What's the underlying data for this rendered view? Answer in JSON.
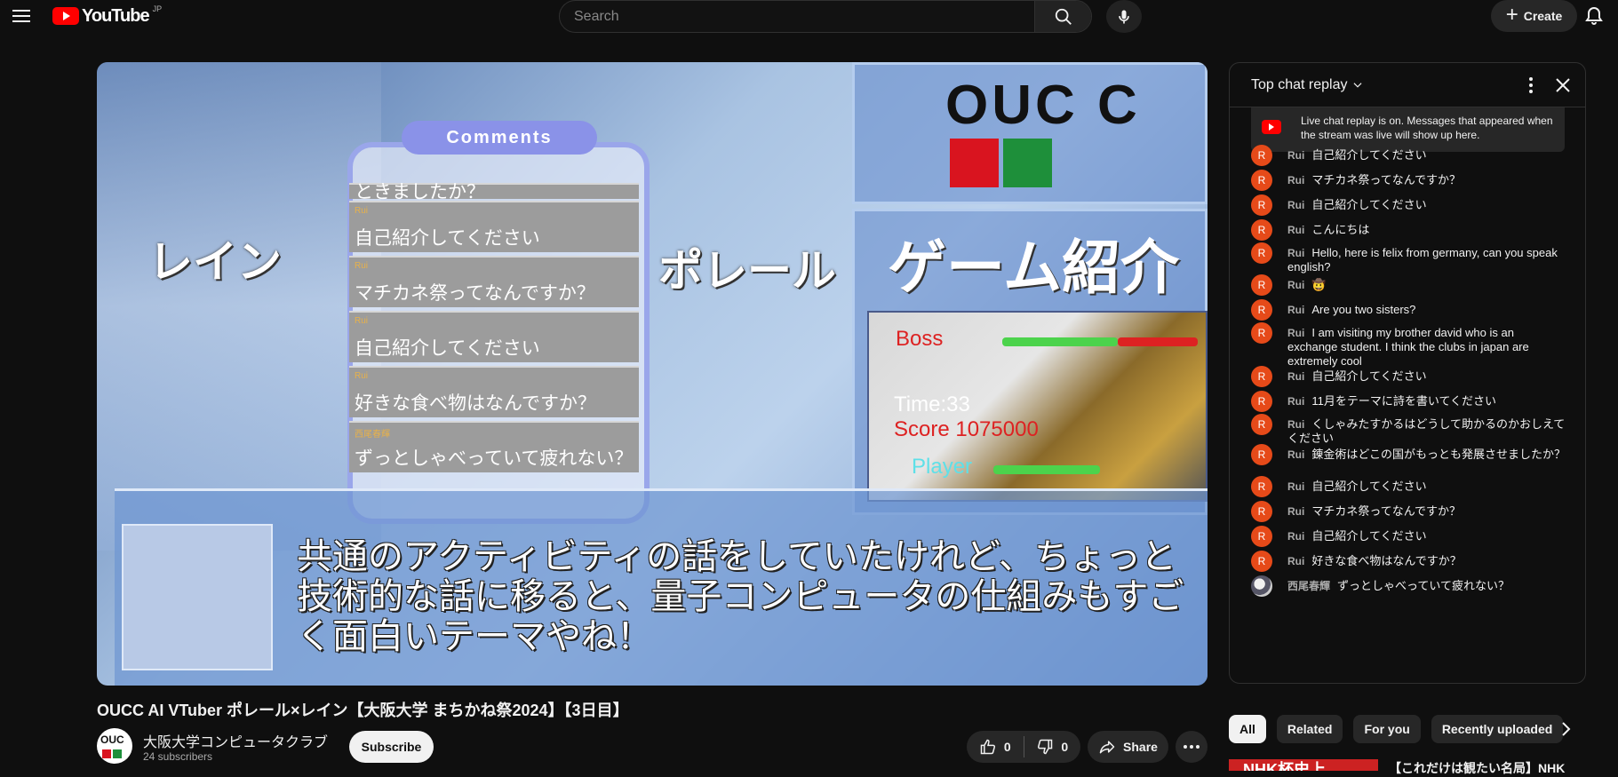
{
  "header": {
    "logo_text": "YouTube",
    "region": "JP",
    "search_placeholder": "Search",
    "create_label": "Create"
  },
  "video": {
    "overlay": {
      "comments_title": "Comments",
      "comments": [
        {
          "author": "",
          "text": "ときましたか？"
        },
        {
          "author": "Rui",
          "text": "自己紹介してください"
        },
        {
          "author": "Rui",
          "text": "マチカネ祭ってなんですか？"
        },
        {
          "author": "Rui",
          "text": "自己紹介してください"
        },
        {
          "author": "Rui",
          "text": "好きな食べ物はなんですか？"
        },
        {
          "author": "西尾春輝",
          "text": "ずっとしゃべっていて疲れない？"
        }
      ],
      "name_left": "レイン",
      "name_right": "ポレール",
      "logo_text": "OUC C",
      "game_title": "ゲーム紹介",
      "game_boss": "Boss",
      "game_time": "Time:33",
      "game_score": "Score 1075000",
      "game_player": "Player",
      "subtitle": "共通のアクティビティの話をしていたけれど、ちょっと技術的な話に移ると、量子コンピュータの仕組みもすごく面白いテーマやね！"
    },
    "title": "OUCC AI VTuber ポレール×レイン【大阪大学 まちかね祭2024】【3日目】",
    "channel": {
      "name": "大阪大学コンピュータクラブ",
      "subscribers": "24 subscribers",
      "avatar_text": "OUC"
    },
    "subscribe_label": "Subscribe",
    "likes": "0",
    "dislikes": "0",
    "share_label": "Share"
  },
  "chat": {
    "title": "Top chat replay",
    "notice": "Live chat replay is on. Messages that appeared when the stream was live will show up here.",
    "messages": [
      {
        "avatar": "R",
        "author": "Rui",
        "text": "自己紹介してください"
      },
      {
        "avatar": "R",
        "author": "Rui",
        "text": "マチカネ祭ってなんですか？"
      },
      {
        "avatar": "R",
        "author": "Rui",
        "text": "自己紹介してください"
      },
      {
        "avatar": "R",
        "author": "Rui",
        "text": "こんにちは"
      },
      {
        "avatar": "R",
        "author": "Rui",
        "text": "Hello, here is felix from germany, can you speak english?"
      },
      {
        "avatar": "R",
        "author": "Rui",
        "text": "🤠"
      },
      {
        "avatar": "R",
        "author": "Rui",
        "text": "Are you two sisters?"
      },
      {
        "avatar": "R",
        "author": "Rui",
        "text": "I am visiting my brother david who is an exchange student. I think the clubs in japan are extremely cool"
      },
      {
        "avatar": "R",
        "author": "Rui",
        "text": "自己紹介してください"
      },
      {
        "avatar": "R",
        "author": "Rui",
        "text": "11月をテーマに詩を書いてください"
      },
      {
        "avatar": "R",
        "author": "Rui",
        "text": "くしゃみたすかるはどうして助かるのかおしえてください"
      },
      {
        "avatar": "R",
        "author": "Rui",
        "text": "錬金術はどこの国がもっとも発展させましたか？"
      },
      {
        "avatar": "R",
        "author": "Rui",
        "text": "自己紹介してください"
      },
      {
        "avatar": "R",
        "author": "Rui",
        "text": "マチカネ祭ってなんですか？"
      },
      {
        "avatar": "R",
        "author": "Rui",
        "text": "自己紹介してください"
      },
      {
        "avatar": "R",
        "author": "Rui",
        "text": "好きな食べ物はなんですか？"
      },
      {
        "avatar": "",
        "author": "西尾春輝",
        "text": "ずっとしゃべっていて疲れない？"
      }
    ]
  },
  "chips": [
    "All",
    "Related",
    "For you",
    "Recently uploaded"
  ],
  "recommendation": {
    "thumb_text": "NHK杯史上",
    "title": "【これだけは観たい名局】NHK"
  }
}
